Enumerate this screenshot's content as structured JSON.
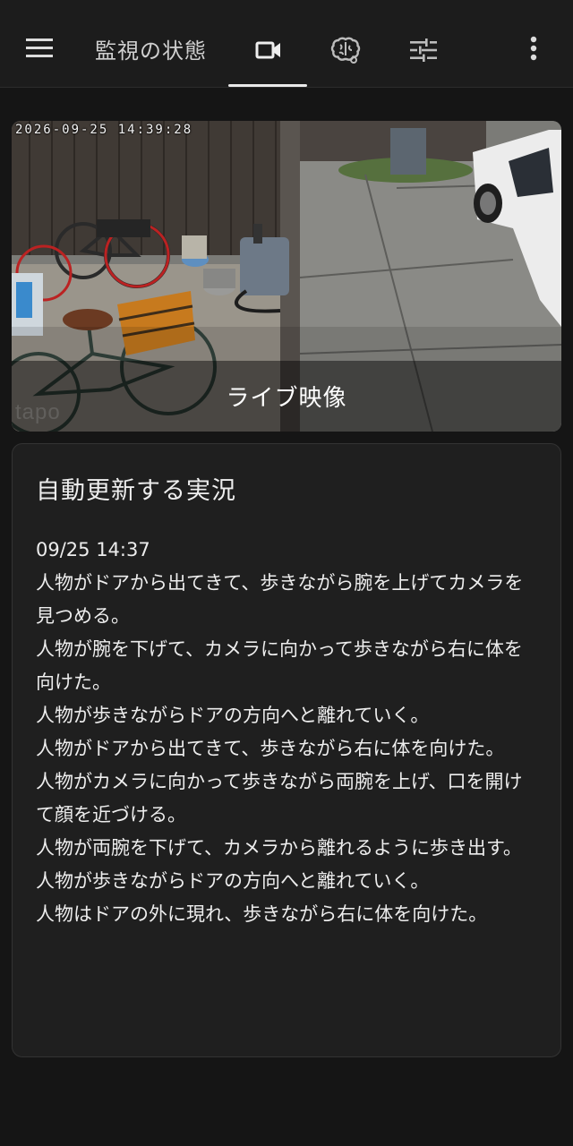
{
  "appbar": {
    "title": "監視の状態",
    "menu_icon": "hamburger-menu-icon",
    "tabs": [
      {
        "icon": "video-camera-icon",
        "selected": true
      },
      {
        "icon": "brain-icon",
        "selected": false
      },
      {
        "icon": "sliders-icon",
        "selected": false
      }
    ],
    "more_icon": "more-vert-icon"
  },
  "camera": {
    "timestamp": "2026-09-25 14:39:28",
    "watermark": "tapo",
    "overlay_label": "ライブ映像"
  },
  "live_card": {
    "title": "自動更新する実況",
    "lines": [
      "09/25 14:37",
      "人物がドアから出てきて、歩きながら腕を上げてカメラを見つめる。",
      "人物が腕を下げて、カメラに向かって歩きながら右に体を向けた。",
      "人物が歩きながらドアの方向へと離れていく。",
      "人物がドアから出てきて、歩きながら右に体を向けた。",
      "人物がカメラに向かって歩きながら両腕を上げ、口を開けて顔を近づける。",
      "人物が両腕を下げて、カメラから離れるように歩き出す。",
      "人物が歩きながらドアの方向へと離れていく。",
      "人物はドアの外に現れ、歩きながら右に体を向けた。"
    ]
  },
  "colors": {
    "background": "#151515",
    "appbar": "#1c1c1c",
    "card": "#1f1f1f",
    "text": "#ededed",
    "indicator": "#e9e9e9"
  }
}
